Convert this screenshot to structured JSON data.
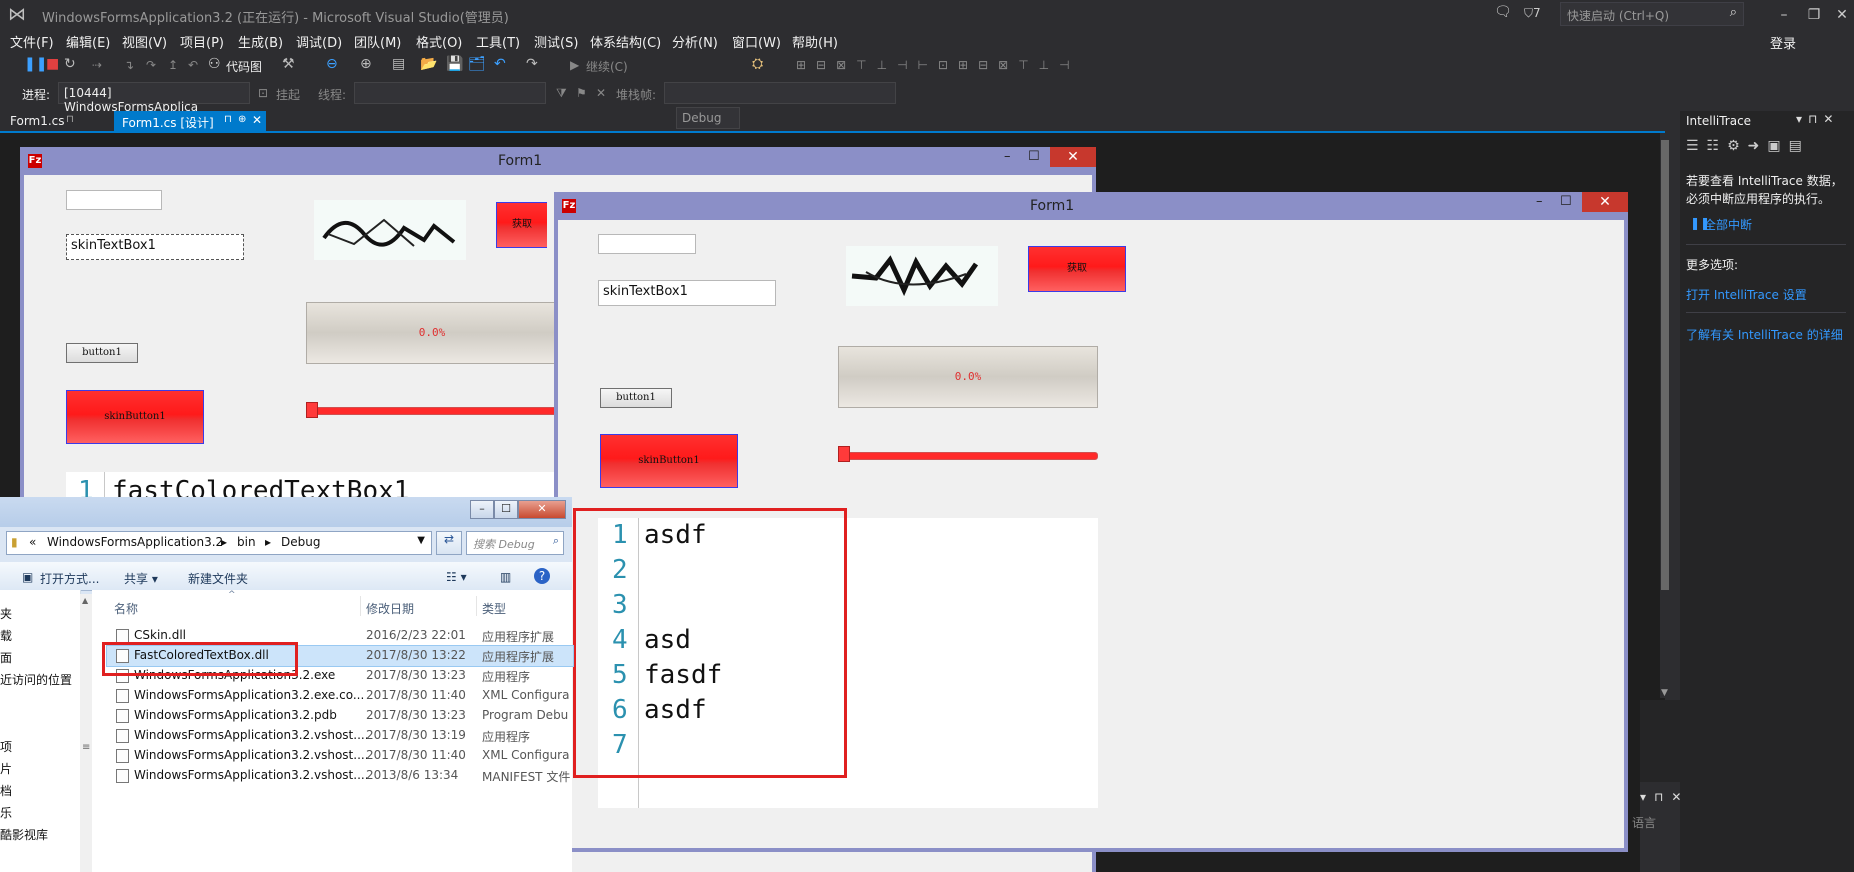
{
  "window": {
    "title": "WindowsFormsApplication3.2 (正在运行) - Microsoft Visual Studio(管理员)",
    "flag_count": "7",
    "quick_launch_placeholder": "快速启动 (Ctrl+Q)",
    "login": "登录"
  },
  "menu": [
    "文件(F)",
    "编辑(E)",
    "视图(V)",
    "项目(P)",
    "生成(B)",
    "调试(D)",
    "团队(M)",
    "格式(O)",
    "工具(T)",
    "测试(S)",
    "体系结构(C)",
    "分析(N)",
    "窗口(W)",
    "帮助(H)"
  ],
  "toolbar": {
    "code_map": "代码图",
    "continue": "继续(C)",
    "config": "Debug",
    "process_label": "进程:",
    "process_value": "[10444] WindowsFormsApplica",
    "suspend": "挂起",
    "thread_label": "线程:",
    "stackframe_label": "堆栈帧:"
  },
  "tabs": [
    {
      "label": "Form1.cs"
    },
    {
      "label": "Form1.cs [设计]"
    }
  ],
  "intellitrace": {
    "title": "IntelliTrace",
    "message": "若要查看 IntelliTrace 数据，必须中断应用程序的执行。",
    "break_all": "全部中断",
    "more_options": "更多选项:",
    "open_settings": "打开 IntelliTrace 设置",
    "learn_more": "了解有关 IntelliTrace 的详细"
  },
  "designer_form": {
    "caption": "Form1",
    "textbox": "skinTextBox1",
    "button1": "button1",
    "skin_button": "skinButton1",
    "get_button": "获取",
    "progress": "0.0%",
    "fctb_line": "1",
    "fctb_text": "fastColoredTextBox1"
  },
  "running_form": {
    "caption": "Form1",
    "textbox": "skinTextBox1",
    "button1": "button1",
    "skin_button": "skinButton1",
    "get_button": "获取",
    "progress": "0.0%",
    "progress_value": 0.0,
    "editor_lines": [
      {
        "num": "1",
        "text": "asdf"
      },
      {
        "num": "2",
        "text": ""
      },
      {
        "num": "3",
        "text": ""
      },
      {
        "num": "4",
        "text": "asd"
      },
      {
        "num": "5",
        "text": "fasdf"
      },
      {
        "num": "6",
        "text": "asdf"
      },
      {
        "num": "7",
        "text": ""
      }
    ]
  },
  "explorer": {
    "address_prefix": "«",
    "address_parts": [
      "WindowsFormsApplication3.2",
      "bin",
      "Debug"
    ],
    "search_placeholder": "搜索 Debug",
    "cmd_open": "打开方式...",
    "cmd_share": "共享 ▾",
    "cmd_new_folder": "新建文件夹",
    "col_name": "名称",
    "col_date": "修改日期",
    "col_type": "类型",
    "nav": [
      "夹",
      "载",
      "面",
      "近访问的位置",
      "",
      "项",
      "片",
      "档",
      "乐",
      "酷影视库"
    ],
    "files": [
      {
        "name": "CSkin.dll",
        "date": "2016/2/23 22:01",
        "type": "应用程序扩展"
      },
      {
        "name": "FastColoredTextBox.dll",
        "date": "2017/8/30 13:22",
        "type": "应用程序扩展"
      },
      {
        "name": "WindowsFormsApplication3.2.exe",
        "date": "2017/8/30 13:23",
        "type": "应用程序"
      },
      {
        "name": "WindowsFormsApplication3.2.exe.co...",
        "date": "2017/8/30 11:40",
        "type": "XML Configura"
      },
      {
        "name": "WindowsFormsApplication3.2.pdb",
        "date": "2017/8/30 13:23",
        "type": "Program Debu"
      },
      {
        "name": "WindowsFormsApplication3.2.vshost....",
        "date": "2017/8/30 13:19",
        "type": "应用程序"
      },
      {
        "name": "WindowsFormsApplication3.2.vshost....",
        "date": "2017/8/30 11:40",
        "type": "XML Configura"
      },
      {
        "name": "WindowsFormsApplication3.2.vshost....",
        "date": "2013/8/6 13:34",
        "type": "MANIFEST 文件"
      }
    ]
  },
  "status": {
    "language": "语言"
  }
}
